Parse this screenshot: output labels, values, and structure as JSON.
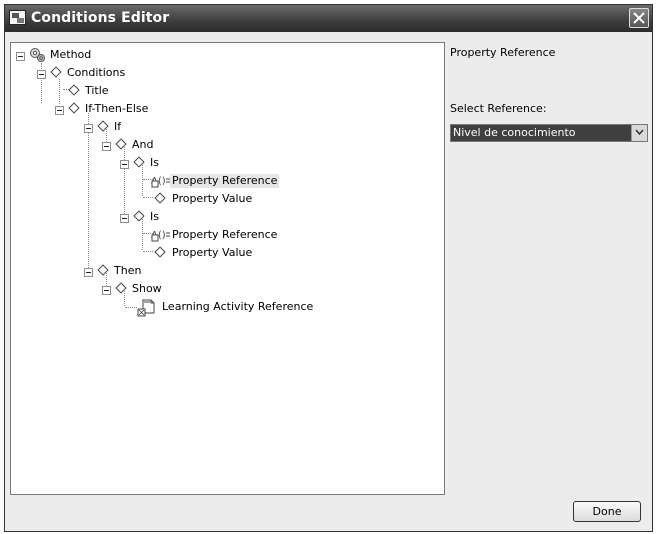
{
  "window": {
    "title": "Conditions Editor"
  },
  "tree": {
    "root": "Method",
    "conditions": "Conditions",
    "title": "Title",
    "if_then_else": "If-Then-Else",
    "if": "If",
    "and": "And",
    "is_1": "Is",
    "property_reference_1": "Property Reference",
    "property_value_1": "Property Value",
    "is_2": "Is",
    "property_reference_2": "Property Reference",
    "property_value_2": "Property Value",
    "then": "Then",
    "show": "Show",
    "learning_activity_reference": "Learning Activity Reference"
  },
  "right_panel": {
    "title": "Property Reference",
    "select_label": "Select Reference:",
    "select_value": "Nivel de conocimiento"
  },
  "buttons": {
    "done": "Done"
  }
}
